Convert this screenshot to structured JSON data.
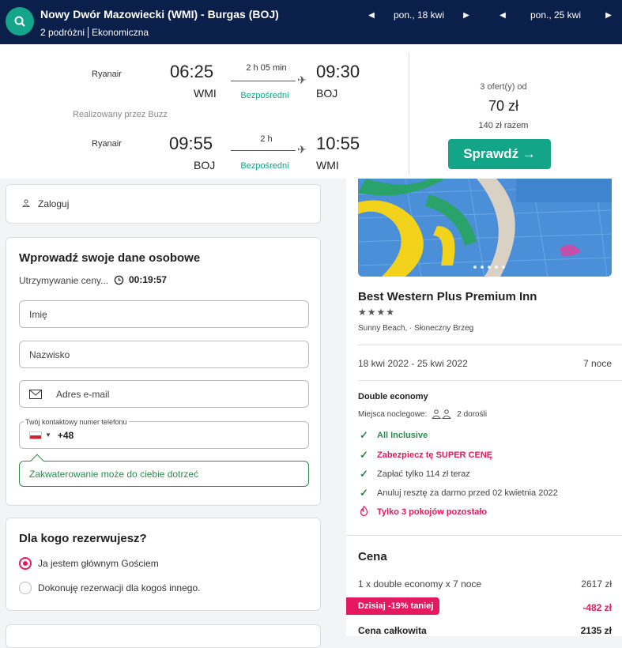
{
  "header": {
    "route": "Nowy Dwór Mazowiecki (WMI) - Burgas (BOJ)",
    "travellers": "2 podróżni",
    "cabin": "Ekonomiczna",
    "date_out": "pon., 18 kwi",
    "date_back": "pon., 25 kwi"
  },
  "flights": {
    "outbound": {
      "airline": "Ryanair",
      "dep_time": "06:25",
      "dep_code": "WMI",
      "duration": "2 h 05 min",
      "type": "Bezpośredni",
      "arr_time": "09:30",
      "arr_code": "BOJ"
    },
    "operated_by": "Realizowany przez Buzz",
    "inbound": {
      "airline": "Ryanair",
      "dep_time": "09:55",
      "dep_code": "BOJ",
      "duration": "2 h",
      "type": "Bezpośredni",
      "arr_time": "10:55",
      "arr_code": "WMI"
    },
    "offers": "3 ofert(y) od",
    "price": "70 zł",
    "total": "140 zł razem",
    "check_label": "Sprawdź →"
  },
  "login": {
    "label": "Zaloguj"
  },
  "personal": {
    "title": "Wprowadź swoje dane osobowe",
    "hold_label": "Utrzymywanie ceny...",
    "timer": "00:19:57",
    "first_name_placeholder": "Imię",
    "last_name_placeholder": "Nazwisko",
    "email_placeholder": "Adres e-mail",
    "phone_label": "Twój kontaktowy numer telefonu",
    "phone_prefix": "+48",
    "notice": "Zakwaterowanie może do ciebie dotrzeć"
  },
  "for_who": {
    "title": "Dla kogo rezerwujesz?",
    "option_main": "Ja jestem głównym Gościem",
    "option_other": "Dokonuję rezerwacji dla kogoś innego."
  },
  "hotel": {
    "name": "Best Western Plus Premium Inn",
    "stars": "★★★★",
    "location": "Sunny Beach, · Słoneczny Brzeg",
    "dates": "18 kwi 2022 - 25 kwi 2022",
    "nights": "7 noce",
    "room": "Double economy",
    "beds_label": "Miejsca noclegowe:",
    "beds_value": "2 dorośli",
    "features": [
      {
        "text": "All Inclusive",
        "color": "#2d8a4e"
      },
      {
        "text": "Zabezpiecz tę SUPER CENĘ",
        "color": "#e5195f"
      },
      {
        "text": "Zapłać tylko 114 zł teraz",
        "color": "#444444"
      },
      {
        "text": "Anuluj resztę za darmo przed 02 kwietnia 2022",
        "color": "#444444"
      }
    ],
    "scarcity": "Tylko 3 pokojów pozostało"
  },
  "price": {
    "title": "Cena",
    "line_label": "1 x double economy x 7 noce",
    "line_value": "2617 zł",
    "discount_label": "Dzisiaj -19% taniej",
    "discount_value": "-482 zł",
    "total_label": "Cena całkowita",
    "total_value": "2135 zł"
  },
  "colors": {
    "accent": "#14a58a",
    "header": "#0b1f4b",
    "pink": "#e5195f",
    "green": "#2d8a4e"
  }
}
